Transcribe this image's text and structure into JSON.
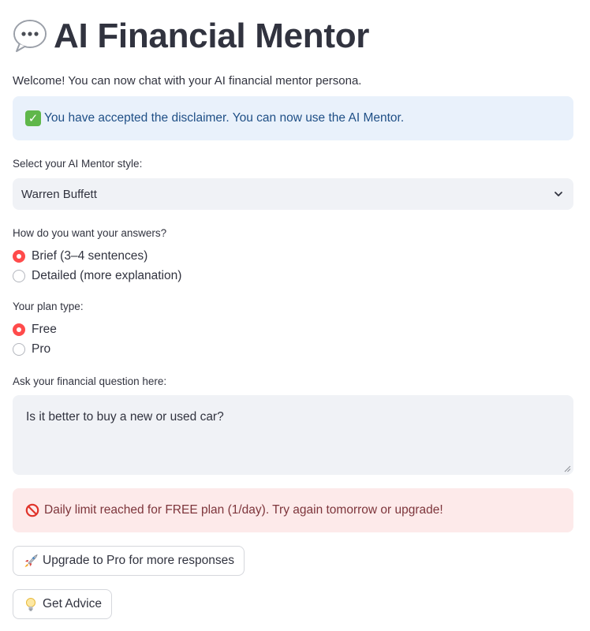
{
  "header": {
    "title": "AI Financial Mentor",
    "icon": "speech-balloon-icon"
  },
  "welcome_text": "Welcome! You can now chat with your AI financial mentor persona.",
  "info": {
    "icon": "check-mark-icon",
    "text": "You have accepted the disclaimer. You can now use the AI Mentor."
  },
  "mentor_style": {
    "label": "Select your AI Mentor style:",
    "selected": "Warren Buffett"
  },
  "answer_length": {
    "label": "How do you want your answers?",
    "options": [
      {
        "label": "Brief (3–4 sentences)",
        "selected": true
      },
      {
        "label": "Detailed (more explanation)",
        "selected": false
      }
    ]
  },
  "plan": {
    "label": "Your plan type:",
    "options": [
      {
        "label": "Free",
        "selected": true
      },
      {
        "label": "Pro",
        "selected": false
      }
    ]
  },
  "question": {
    "label": "Ask your financial question here:",
    "value": "Is it better to buy a new or used car?"
  },
  "error": {
    "icon": "prohibited-icon",
    "text": "Daily limit reached for FREE plan (1/day). Try again tomorrow or upgrade!"
  },
  "buttons": {
    "upgrade": {
      "label": "Upgrade to Pro for more responses",
      "icon": "rocket-icon"
    },
    "advice": {
      "label": "Get Advice",
      "icon": "light-bulb-icon"
    }
  },
  "colors": {
    "accent": "#ff4b4b",
    "info_bg": "#e9f1fb",
    "info_text": "#1f4f86",
    "error_bg": "#fdeaea",
    "error_text": "#7d353b",
    "input_bg": "#f0f2f6"
  }
}
